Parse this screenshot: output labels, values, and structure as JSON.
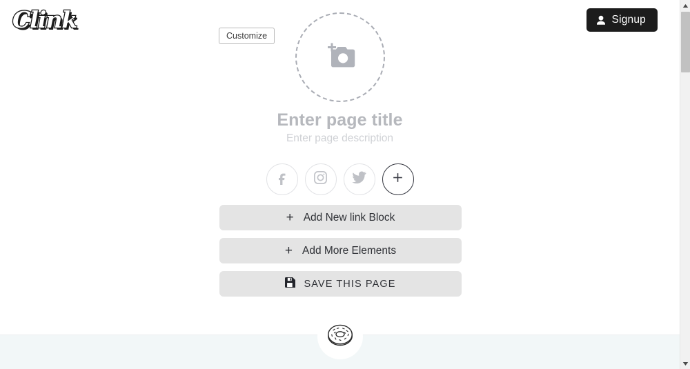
{
  "header": {
    "logo_text": "Clink",
    "signup_label": "Signup",
    "signup_icon": "person-icon",
    "signup_bg": "#1c1c1c",
    "customize_label": "Customize"
  },
  "profile": {
    "avatar_placeholder_icon": "add-a-photo-icon",
    "title_placeholder": "Enter page title",
    "description_placeholder": "Enter page description",
    "title_color": "#b6b8bd",
    "description_color": "#cfd1d5"
  },
  "socials": {
    "items": [
      {
        "name": "facebook",
        "icon": "facebook-icon",
        "label": "f"
      },
      {
        "name": "instagram",
        "icon": "instagram-icon",
        "label": ""
      },
      {
        "name": "twitter",
        "icon": "twitter-icon",
        "label": ""
      },
      {
        "name": "add",
        "icon": "plus-icon",
        "label": "+"
      }
    ]
  },
  "actions": {
    "add_link_block": {
      "label": "Add New link Block",
      "icon": "plus-icon"
    },
    "add_more_elements": {
      "label": "Add More Elements",
      "icon": "plus-icon"
    },
    "save_page": {
      "label": "SAVE THIS PAGE",
      "icon": "save-floppy-icon"
    },
    "button_bg": "#e4e4e4"
  },
  "footer": {
    "badge_icon": "donut-icon",
    "band_color": "#f2f7f8"
  },
  "scrollbar": {
    "up_arrow_icon": "caret-up-icon",
    "down_arrow_icon": "caret-down-icon",
    "thumb_color": "#c1c1c1"
  }
}
